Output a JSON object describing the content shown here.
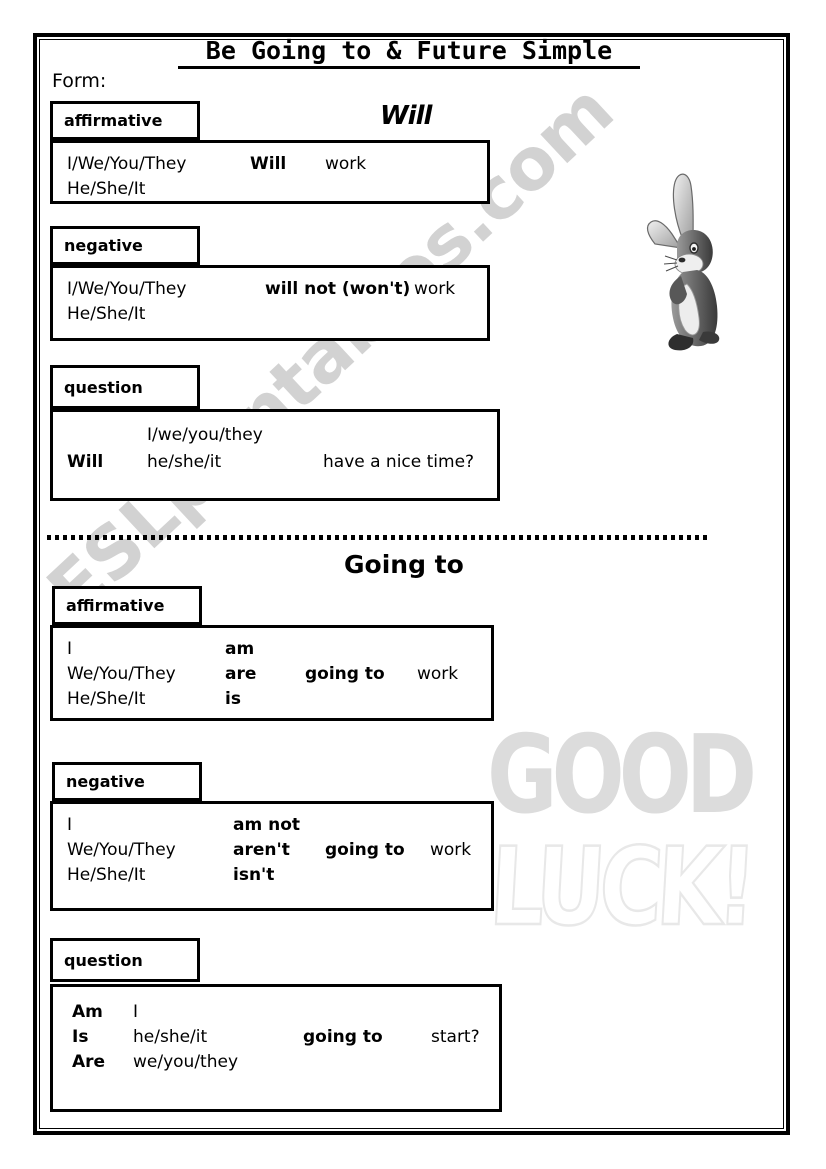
{
  "document": {
    "title": "Be Going to & Future Simple",
    "form_label": "Form:"
  },
  "watermarks": {
    "diagonal": "ESLprintables.com",
    "good": "GOOD",
    "luck": "LUCK!",
    "color_filled": "#dcdcdc",
    "color_outline": "#e8e8e8",
    "color_diagonal": "#d2d2d2"
  },
  "illustration": {
    "name": "cartoon-rabbit",
    "description": "grayscale cartoon rabbit"
  },
  "sections": [
    {
      "heading": "Will",
      "blocks": [
        {
          "tab": "affirmative",
          "lines": [
            {
              "subject": "I/We/You/They",
              "aux": "Will",
              "verb": "work"
            },
            {
              "subject": "He/She/It",
              "aux": "",
              "verb": ""
            }
          ]
        },
        {
          "tab": "negative",
          "lines": [
            {
              "subject": "I/We/You/They",
              "aux": "will not (won't)",
              "verb": "work"
            },
            {
              "subject": "He/She/It",
              "aux": "",
              "verb": ""
            }
          ]
        },
        {
          "tab": "question",
          "lines": [
            {
              "aux": "",
              "subject": "I/we/you/they",
              "verb": ""
            },
            {
              "aux": "Will",
              "subject": "he/she/it",
              "verb": "have a nice time?"
            }
          ]
        }
      ]
    },
    {
      "heading": "Going to",
      "blocks": [
        {
          "tab": "affirmative",
          "lines": [
            {
              "subject": "I",
              "be": "am",
              "going": "",
              "verb": ""
            },
            {
              "subject": "We/You/They",
              "be": "are",
              "going": "going to",
              "verb": "work"
            },
            {
              "subject": "He/She/It",
              "be": "is",
              "going": "",
              "verb": ""
            }
          ]
        },
        {
          "tab": "negative",
          "lines": [
            {
              "subject": "I",
              "be": "am not",
              "going": "",
              "verb": ""
            },
            {
              "subject": "We/You/They",
              "be": "aren't",
              "going": "going to",
              "verb": "work"
            },
            {
              "subject": "He/She/It",
              "be": "isn't",
              "going": "",
              "verb": ""
            }
          ]
        },
        {
          "tab": "question",
          "lines": [
            {
              "be": "Am",
              "subject": "I",
              "going": "",
              "verb": ""
            },
            {
              "be": "Is",
              "subject": "he/she/it",
              "going": "going to",
              "verb": "start?"
            },
            {
              "be": "Are",
              "subject": "we/you/they",
              "going": "",
              "verb": ""
            }
          ]
        }
      ]
    }
  ]
}
